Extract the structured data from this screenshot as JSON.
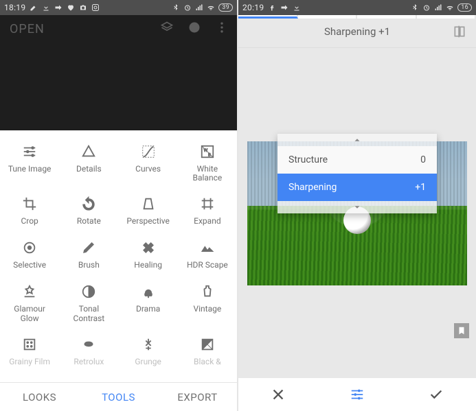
{
  "left": {
    "statusbar": {
      "time": "18:19",
      "battery": "39"
    },
    "header": {
      "open_label": "OPEN"
    },
    "tools": [
      {
        "id": "tune-image",
        "label": "Tune Image"
      },
      {
        "id": "details",
        "label": "Details"
      },
      {
        "id": "curves",
        "label": "Curves"
      },
      {
        "id": "white-balance",
        "label": "White\nBalance"
      },
      {
        "id": "crop",
        "label": "Crop"
      },
      {
        "id": "rotate",
        "label": "Rotate"
      },
      {
        "id": "perspective",
        "label": "Perspective"
      },
      {
        "id": "expand",
        "label": "Expand"
      },
      {
        "id": "selective",
        "label": "Selective"
      },
      {
        "id": "brush",
        "label": "Brush"
      },
      {
        "id": "healing",
        "label": "Healing"
      },
      {
        "id": "hdr-scape",
        "label": "HDR Scape"
      },
      {
        "id": "glamour-glow",
        "label": "Glamour\nGlow"
      },
      {
        "id": "tonal-contrast",
        "label": "Tonal\nContrast"
      },
      {
        "id": "drama",
        "label": "Drama"
      },
      {
        "id": "vintage",
        "label": "Vintage"
      },
      {
        "id": "grainy-film",
        "label": "Grainy Film"
      },
      {
        "id": "retrolux",
        "label": "Retrolux"
      },
      {
        "id": "grunge",
        "label": "Grunge"
      },
      {
        "id": "black-white",
        "label": "Black &"
      }
    ],
    "tabs": {
      "looks": "LOOKS",
      "tools": "TOOLS",
      "export": "EXPORT",
      "active": "tools"
    }
  },
  "right": {
    "statusbar": {
      "time": "20:19",
      "battery": "16"
    },
    "title": "Sharpening +1",
    "adjust": {
      "rows": [
        {
          "name": "Structure",
          "value": "0",
          "selected": false
        },
        {
          "name": "Sharpening",
          "value": "+1",
          "selected": true
        }
      ]
    }
  }
}
